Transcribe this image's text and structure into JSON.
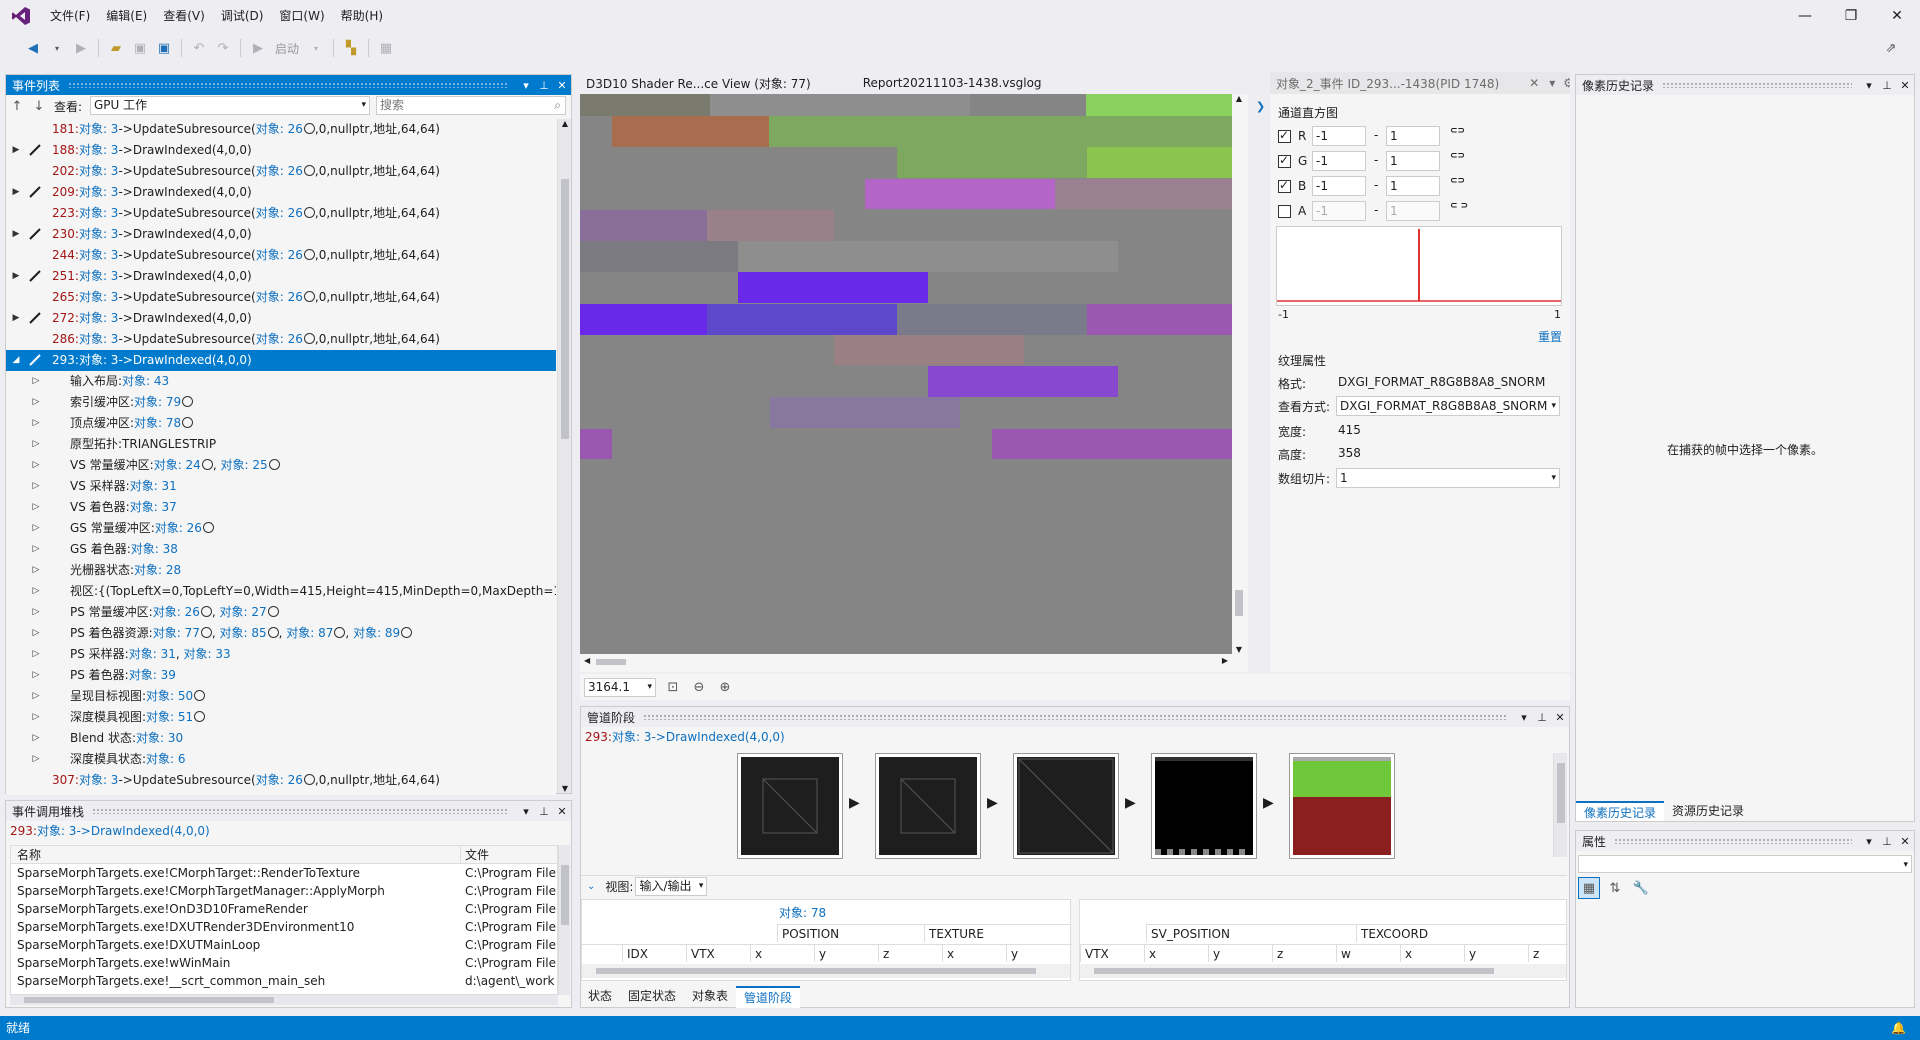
{
  "menu": {
    "items": [
      "文件(F)",
      "编辑(E)",
      "查看(V)",
      "调试(D)",
      "窗口(W)",
      "帮助(H)"
    ]
  },
  "toolbar": {
    "start_label": "启动"
  },
  "event_list": {
    "title": "事件列表",
    "view_label": "查看:",
    "view_value": "GPU 工作",
    "search_placeholder": "搜索",
    "rows": [
      {
        "num": "181:",
        "text": "对象: 3->UpdateSubresource(对象: 26",
        "tail": ",0,nullptr,地址,64,64)",
        "kind": "update"
      },
      {
        "num": "188:",
        "text": "对象: 3->DrawIndexed(4,0,0)",
        "tail": "",
        "kind": "draw"
      },
      {
        "num": "202:",
        "text": "对象: 3->UpdateSubresource(对象: 26",
        "tail": ",0,nullptr,地址,64,64)",
        "kind": "update"
      },
      {
        "num": "209:",
        "text": "对象: 3->DrawIndexed(4,0,0)",
        "tail": "",
        "kind": "draw"
      },
      {
        "num": "223:",
        "text": "对象: 3->UpdateSubresource(对象: 26",
        "tail": ",0,nullptr,地址,64,64)",
        "kind": "update"
      },
      {
        "num": "230:",
        "text": "对象: 3->DrawIndexed(4,0,0)",
        "tail": "",
        "kind": "draw"
      },
      {
        "num": "244:",
        "text": "对象: 3->UpdateSubresource(对象: 26",
        "tail": ",0,nullptr,地址,64,64)",
        "kind": "update"
      },
      {
        "num": "251:",
        "text": "对象: 3->DrawIndexed(4,0,0)",
        "tail": "",
        "kind": "draw"
      },
      {
        "num": "265:",
        "text": "对象: 3->UpdateSubresource(对象: 26",
        "tail": ",0,nullptr,地址,64,64)",
        "kind": "update"
      },
      {
        "num": "272:",
        "text": "对象: 3->DrawIndexed(4,0,0)",
        "tail": "",
        "kind": "draw"
      },
      {
        "num": "286:",
        "text": "对象: 3->UpdateSubresource(对象: 26",
        "tail": ",0,nullptr,地址,64,64)",
        "kind": "update"
      }
    ],
    "selected": {
      "num": "293:",
      "text": "对象: 3->DrawIndexed(4,0,0)"
    },
    "children": [
      {
        "label": "输入布局:",
        "link": "对象: 43",
        "rest": ""
      },
      {
        "label": "索引缓冲区:",
        "link": "对象: 79",
        "rest": "",
        "clock": true
      },
      {
        "label": "顶点缓冲区:",
        "link": "对象: 78",
        "rest": "",
        "clock": true
      },
      {
        "label": "原型拓扑:TRIANGLESTRIP",
        "link": "",
        "rest": ""
      },
      {
        "label": "VS 常量缓冲区:",
        "link": "对象: 24",
        "rest": "",
        "clock": true,
        "link2": "对象: 25"
      },
      {
        "label": "VS 采样器:",
        "link": "对象: 31",
        "rest": ""
      },
      {
        "label": "VS 着色器:",
        "link": "对象: 37",
        "rest": ""
      },
      {
        "label": "GS 常量缓冲区:",
        "link": "对象: 26",
        "rest": "",
        "clock": true
      },
      {
        "label": "GS 着色器:",
        "link": "对象: 38",
        "rest": ""
      },
      {
        "label": "光栅器状态:",
        "link": "对象: 28",
        "rest": ""
      },
      {
        "label": "视区:{(TopLeftX=0,TopLeftY=0,Width=415,Height=415,MinDepth=0,MaxDepth=1)}",
        "link": "",
        "rest": ""
      },
      {
        "label": "PS 常量缓冲区:",
        "link": "对象: 26",
        "rest": "",
        "clock": true,
        "link2": "对象: 27"
      },
      {
        "label": "PS 着色器资源:",
        "link": "对象: 77",
        "rest": "",
        "clock": true,
        "link2": "对象: 85",
        "link3": "对象: 87",
        "link4": "对象: 89"
      },
      {
        "label": "PS 采样器:",
        "link": "对象: 31",
        "rest": ", ",
        "link2b": "对象: 33"
      },
      {
        "label": "PS 着色器:",
        "link": "对象: 39",
        "rest": ""
      },
      {
        "label": "呈现目标视图:",
        "link": "对象: 50",
        "rest": "",
        "clock": true
      },
      {
        "label": "深度模具视图:",
        "link": "对象: 51",
        "rest": "",
        "clock": true
      },
      {
        "label": "Blend 状态:",
        "link": "对象: 30",
        "rest": ""
      },
      {
        "label": "深度模具状态:",
        "link": "对象: 6",
        "rest": ""
      }
    ],
    "last_row": {
      "num": "307:",
      "text": "对象: 3->UpdateSubresource(对象: 26",
      "tail": ",0,nullptr,地址,64,64)"
    }
  },
  "call_stack": {
    "title": "事件调用堆栈",
    "current_num": "293:",
    "current_text": "对象: 3->DrawIndexed(4,0,0)",
    "col_name": "名称",
    "col_file": "文件",
    "rows": [
      {
        "name": "SparseMorphTargets.exe!CMorphTarget::RenderToTexture",
        "file": "C:\\Program File"
      },
      {
        "name": "SparseMorphTargets.exe!CMorphTargetManager::ApplyMorph",
        "file": "C:\\Program File"
      },
      {
        "name": "SparseMorphTargets.exe!OnD3D10FrameRender",
        "file": "C:\\Program File"
      },
      {
        "name": "SparseMorphTargets.exe!DXUTRender3DEnvironment10",
        "file": "C:\\Program File"
      },
      {
        "name": "SparseMorphTargets.exe!DXUTMainLoop",
        "file": "C:\\Program File"
      },
      {
        "name": "SparseMorphTargets.exe!wWinMain",
        "file": "C:\\Program File"
      },
      {
        "name": "SparseMorphTargets.exe!__scrt_common_main_seh",
        "file": "d:\\agent\\_work"
      }
    ]
  },
  "docs": {
    "tab1": "D3D10 Shader Re...ce View (对象: 77)",
    "tab2": "Report20211103-1438.vsglog",
    "tab3": "对象_2_事件 ID_293...-1438(PID 1748)",
    "zoom": "3164.1"
  },
  "histogram": {
    "title": "通道直方图",
    "channels": [
      {
        "name": "R",
        "on": true,
        "min": "-1",
        "max": "1"
      },
      {
        "name": "G",
        "on": true,
        "min": "-1",
        "max": "1"
      },
      {
        "name": "B",
        "on": true,
        "min": "-1",
        "max": "1"
      },
      {
        "name": "A",
        "on": false,
        "min": "-1",
        "max": "1"
      }
    ],
    "axis_min": "-1",
    "axis_max": "1",
    "reset": "重置"
  },
  "texture_props": {
    "title": "纹理属性",
    "format_label": "格式:",
    "format_value": "DXGI_FORMAT_R8G8B8A8_SNORM",
    "viewmode_label": "查看方式:",
    "viewmode_value": "DXGI_FORMAT_R8G8B8A8_SNORM",
    "width_label": "宽度:",
    "width_value": "415",
    "height_label": "高度:",
    "height_value": "358",
    "slice_label": "数组切片:",
    "slice_value": "1"
  },
  "pipeline": {
    "title": "管道阶段",
    "current_num": "293:",
    "current_text": "对象: 3->DrawIndexed(4,0,0)",
    "view_label": "视图:",
    "view_value": "输入/输出",
    "obj_label": "对象: 78",
    "left_groups": [
      "POSITION",
      "TEXTURE"
    ],
    "left_cols": [
      "IDX",
      "VTX",
      "x",
      "y",
      "z",
      "x",
      "y"
    ],
    "right_groups": [
      "SV_POSITION",
      "TEXCOORD"
    ],
    "right_cols": [
      "VTX",
      "x",
      "y",
      "z",
      "w",
      "x",
      "y",
      "z"
    ]
  },
  "bottom_tabs": [
    "状态",
    "固定状态",
    "对象表",
    "管道阶段"
  ],
  "pixel_history": {
    "title": "像素历史记录",
    "message": "在捕获的帧中选择一个像素。",
    "tab1": "像素历史记录",
    "tab2": "资源历史记录"
  },
  "properties": {
    "title": "属性"
  },
  "status": {
    "text": "就绪"
  },
  "colors": {
    "accent": "#007acc",
    "selection": "#007acc",
    "link": "#0e70c0",
    "event_number": "#a31515"
  }
}
